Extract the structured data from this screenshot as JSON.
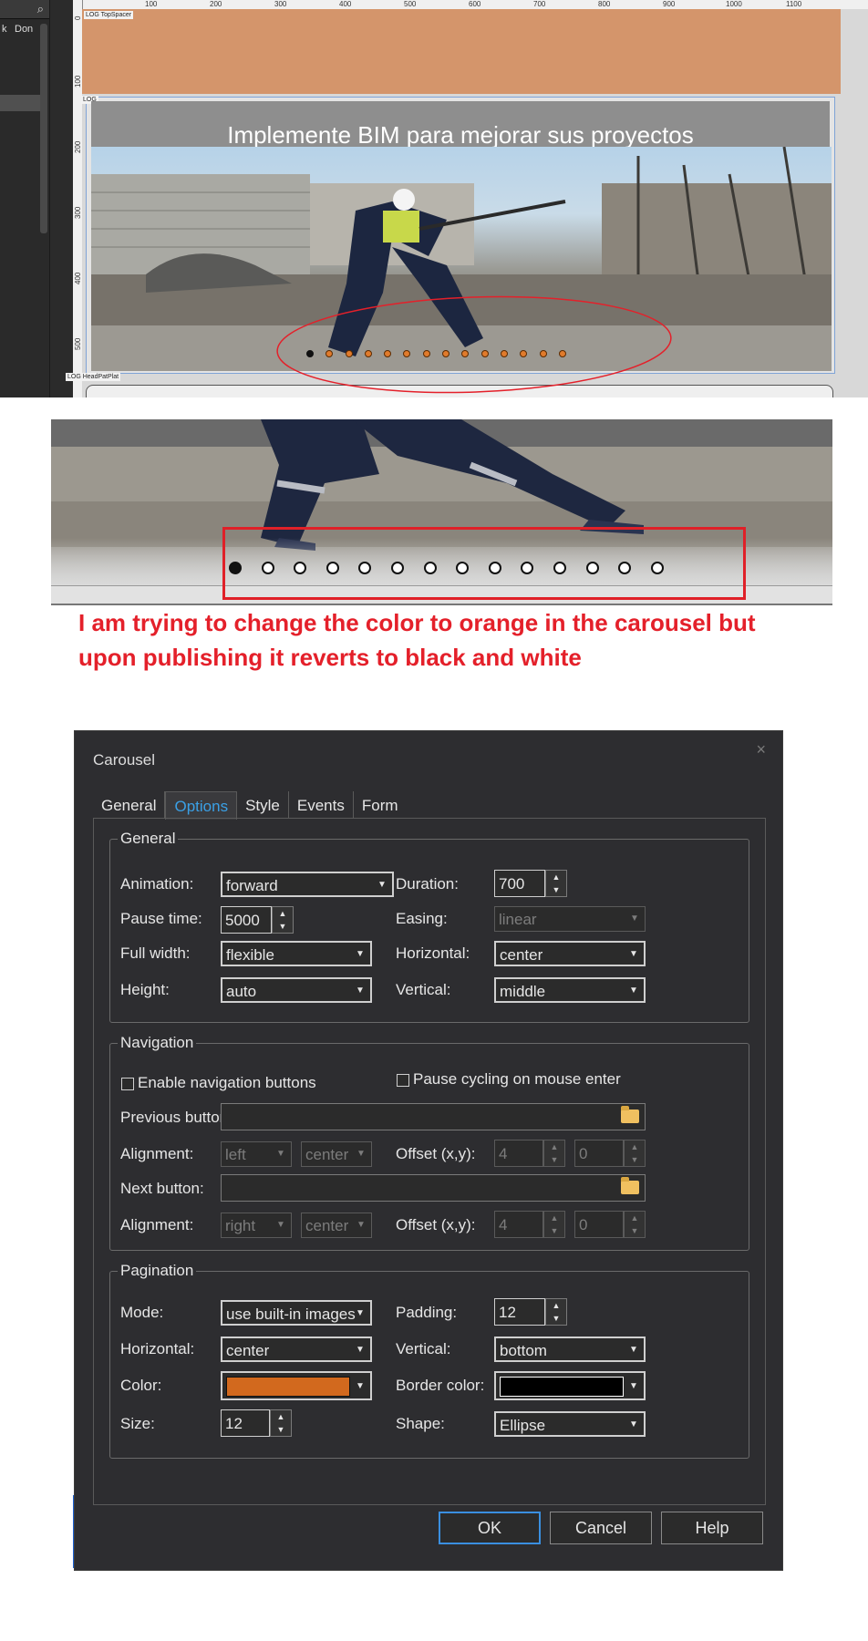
{
  "editor": {
    "left_panel_tabs": [
      "k",
      "Don"
    ],
    "ruler_top_ticks": [
      "0",
      "100",
      "200",
      "300",
      "400",
      "500",
      "600",
      "700",
      "800",
      "900",
      "1000",
      "1100"
    ],
    "ruler_left_ticks": [
      "0",
      "100",
      "200",
      "300",
      "400",
      "500"
    ],
    "layer_top_spacer": "LOG TopSpacer",
    "layer_slider": "LOG",
    "layer_head_pat": "LOG HeadPatPlat",
    "slider_title": "Implemente BIM para mejorar sus proyectos",
    "dot_count": 14,
    "active_dot_index": 0,
    "dot_color": "#e07b2c"
  },
  "preview": {
    "dot_count": 14,
    "active_dot_index": 0
  },
  "annotation": {
    "note": "I am trying to change the color to orange in the carousel but upon publishing it reverts to black and white",
    "color": "#e4202a"
  },
  "dialog": {
    "title": "Carousel",
    "close_icon": "×",
    "tabs": [
      {
        "label": "General",
        "active": false
      },
      {
        "label": "Options",
        "active": true
      },
      {
        "label": "Style",
        "active": false
      },
      {
        "label": "Events",
        "active": false
      },
      {
        "label": "Form",
        "active": false
      }
    ],
    "general": {
      "legend": "General",
      "animation_label": "Animation:",
      "animation_value": "forward",
      "duration_label": "Duration:",
      "duration_value": "700",
      "pause_label": "Pause time:",
      "pause_value": "5000",
      "easing_label": "Easing:",
      "easing_value": "linear",
      "fullwidth_label": "Full width:",
      "fullwidth_value": "flexible",
      "horizontal_label": "Horizontal:",
      "horizontal_value": "center",
      "height_label": "Height:",
      "height_value": "auto",
      "vertical_label": "Vertical:",
      "vertical_value": "middle"
    },
    "navigation": {
      "legend": "Navigation",
      "enable_label": "Enable navigation buttons",
      "pause_label": "Pause cycling on mouse enter",
      "prev_label": "Previous button:",
      "prev_value": "",
      "align1_label": "Alignment:",
      "align1_h": "left",
      "align1_v": "center",
      "offset1_label": "Offset (x,y):",
      "offset1_x": "4",
      "offset1_y": "0",
      "next_label": "Next button:",
      "next_value": "",
      "align2_label": "Alignment:",
      "align2_h": "right",
      "align2_v": "center",
      "offset2_label": "Offset (x,y):",
      "offset2_x": "4",
      "offset2_y": "0"
    },
    "pagination": {
      "legend": "Pagination",
      "mode_label": "Mode:",
      "mode_value": "use built-in images",
      "padding_label": "Padding:",
      "padding_value": "12",
      "horizontal_label": "Horizontal:",
      "horizontal_value": "center",
      "vertical_label": "Vertical:",
      "vertical_value": "bottom",
      "color_label": "Color:",
      "color_value": "#d2691e",
      "border_color_label": "Border color:",
      "border_color_value": "#000000",
      "size_label": "Size:",
      "size_value": "12",
      "shape_label": "Shape:",
      "shape_value": "Ellipse"
    },
    "buttons": {
      "ok": "OK",
      "cancel": "Cancel",
      "help": "Help"
    }
  }
}
